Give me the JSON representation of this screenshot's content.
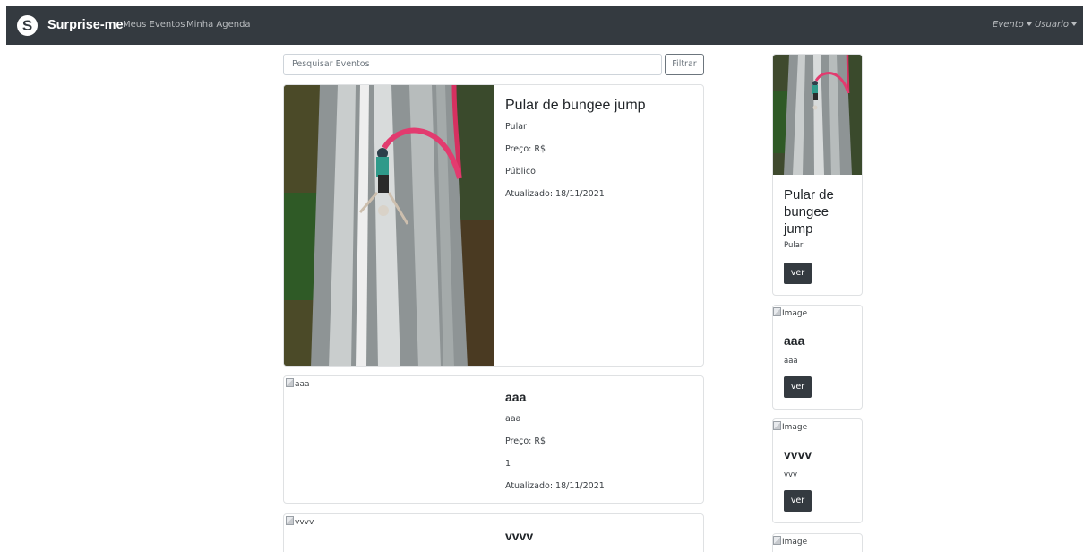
{
  "navbar": {
    "logo_letter": "S",
    "brand": "Surprise-me",
    "links": [
      "Meus Eventos",
      "Minha Agenda"
    ],
    "right_menus": [
      "Evento",
      "Usuario"
    ]
  },
  "search": {
    "placeholder": "Pesquisar Eventos",
    "button_label": "Filtrar"
  },
  "events": [
    {
      "title": "Pular de bungee jump",
      "description": "Pular",
      "price": "Preço: R$",
      "visibility": "Público",
      "updated": "Atualizado: 18/11/2021",
      "image": "bungee-jump-waterfall"
    },
    {
      "title": "aaa",
      "image_alt": "aaa",
      "description": "aaa",
      "price": "Preço: R$",
      "visibility": "1",
      "updated": "Atualizado: 18/11/2021"
    },
    {
      "title": "vvvv",
      "image_alt": "vvvv"
    }
  ],
  "sidebar": [
    {
      "title": "Pular de bungee jump",
      "description": "Pular",
      "button": "ver",
      "image": "bungee-jump-waterfall"
    },
    {
      "image_alt": "Image",
      "title": "aaa",
      "description": "aaa",
      "button": "ver"
    },
    {
      "image_alt": "Image",
      "title": "vvvv",
      "description": "vvv",
      "button": "ver"
    },
    {
      "image_alt": "Image"
    }
  ],
  "colors": {
    "navbar": "#343a40",
    "button_dark": "#343a40",
    "card_border": "#dfe1e3"
  }
}
